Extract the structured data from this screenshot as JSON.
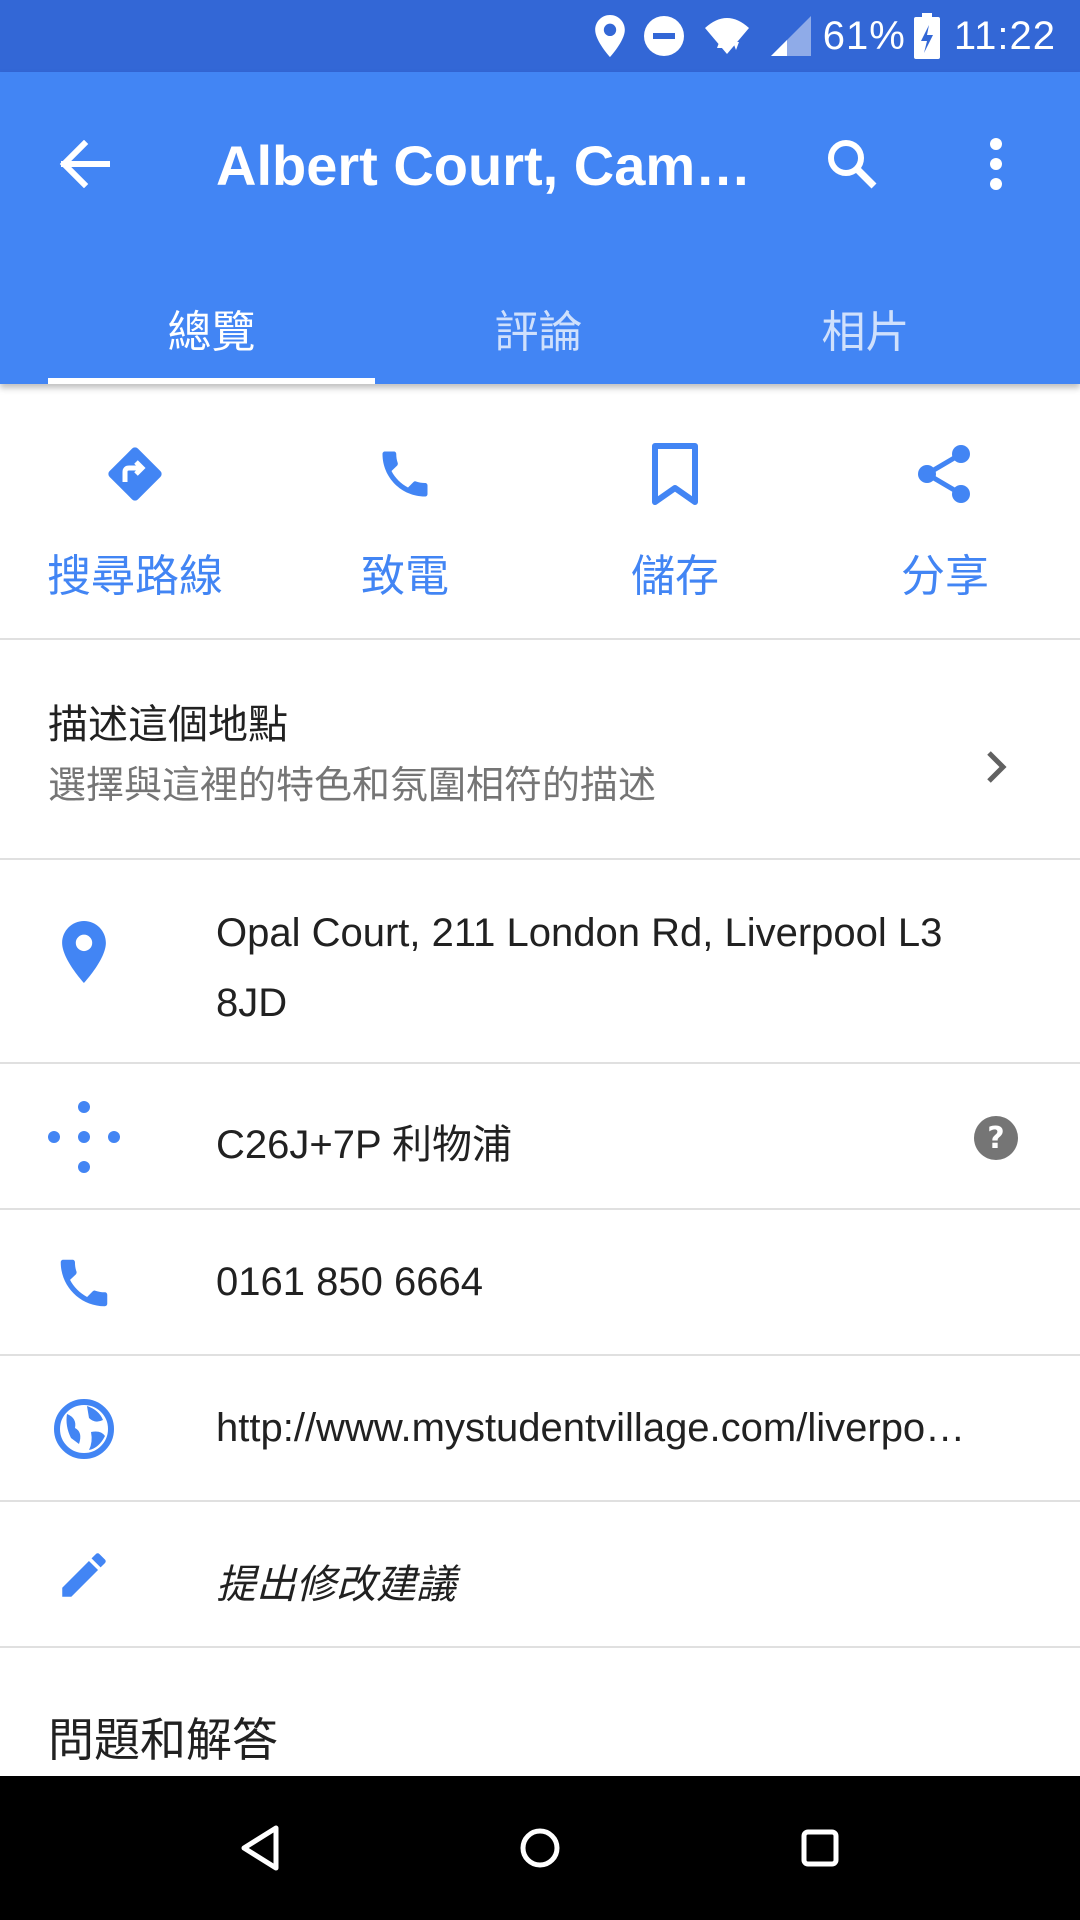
{
  "status_bar": {
    "battery": "61%",
    "time": "11:22",
    "icons": [
      "location-icon",
      "do-not-disturb-icon",
      "wifi-icon",
      "signal-icon",
      "battery-charging-icon"
    ]
  },
  "app_bar": {
    "title": "Albert Court, Camp…",
    "tabs": [
      {
        "label": "總覽",
        "active": true
      },
      {
        "label": "評論",
        "active": false
      },
      {
        "label": "相片",
        "active": false
      }
    ]
  },
  "actions": [
    {
      "label": "搜尋路線",
      "icon": "directions-icon"
    },
    {
      "label": "致電",
      "icon": "phone-icon"
    },
    {
      "label": "儲存",
      "icon": "bookmark-icon"
    },
    {
      "label": "分享",
      "icon": "share-icon"
    }
  ],
  "describe": {
    "title": "描述這個地點",
    "subtitle": "選擇與這裡的特色和氛圍相符的描述"
  },
  "info": {
    "address": "Opal Court, 211 London Rd, Liverpool L3 8JD",
    "plus_code": "C26J+7P 利物浦",
    "help": "?",
    "phone": "0161 850 6664",
    "website": "http://www.mystudentvillage.com/liverpo…",
    "suggest_edit": "提出修改建議"
  },
  "qa": {
    "title": "問題和解答"
  },
  "colors": {
    "status_bar": "#3367d6",
    "app_bar": "#4285f4",
    "accent": "#4285f4"
  }
}
